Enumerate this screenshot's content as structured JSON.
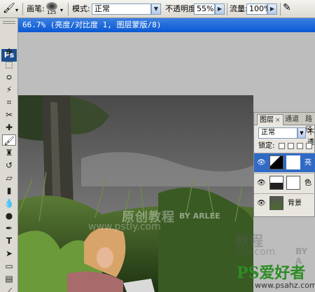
{
  "options_bar": {
    "brush_label": "画笔:",
    "brush_size": "125",
    "mode_label": "模式:",
    "mode_value": "正常",
    "opacity_label": "不透明度:",
    "opacity_value": "55%",
    "flow_label": "流量:",
    "flow_value": "100%"
  },
  "document": {
    "title": "66.7% (亮度/对比度 1, 图层蒙版/8)"
  },
  "toolbox": {
    "logo": "Ps"
  },
  "layers_panel": {
    "tabs": [
      {
        "label": "图层",
        "close": "×"
      },
      {
        "label": "通道"
      },
      {
        "label": "路径"
      }
    ],
    "blend_mode": "正常",
    "opacity_label": "不透",
    "lock_label": "锁定:",
    "layers": [
      {
        "name": "亮",
        "selected": true
      },
      {
        "name": "色",
        "selected": false
      },
      {
        "name": "背景",
        "selected": false
      }
    ]
  },
  "canvas": {
    "watermark_main": "原创教程",
    "watermark_by": "BY ARLEE",
    "watermark_url": "www.pstly.com",
    "watermark_right": "教程",
    "watermark_right2": "stly.com",
    "watermark_right3": "BY A"
  },
  "site_watermark": {
    "brand": "PS爱好者",
    "url": "www.psahz.com"
  }
}
